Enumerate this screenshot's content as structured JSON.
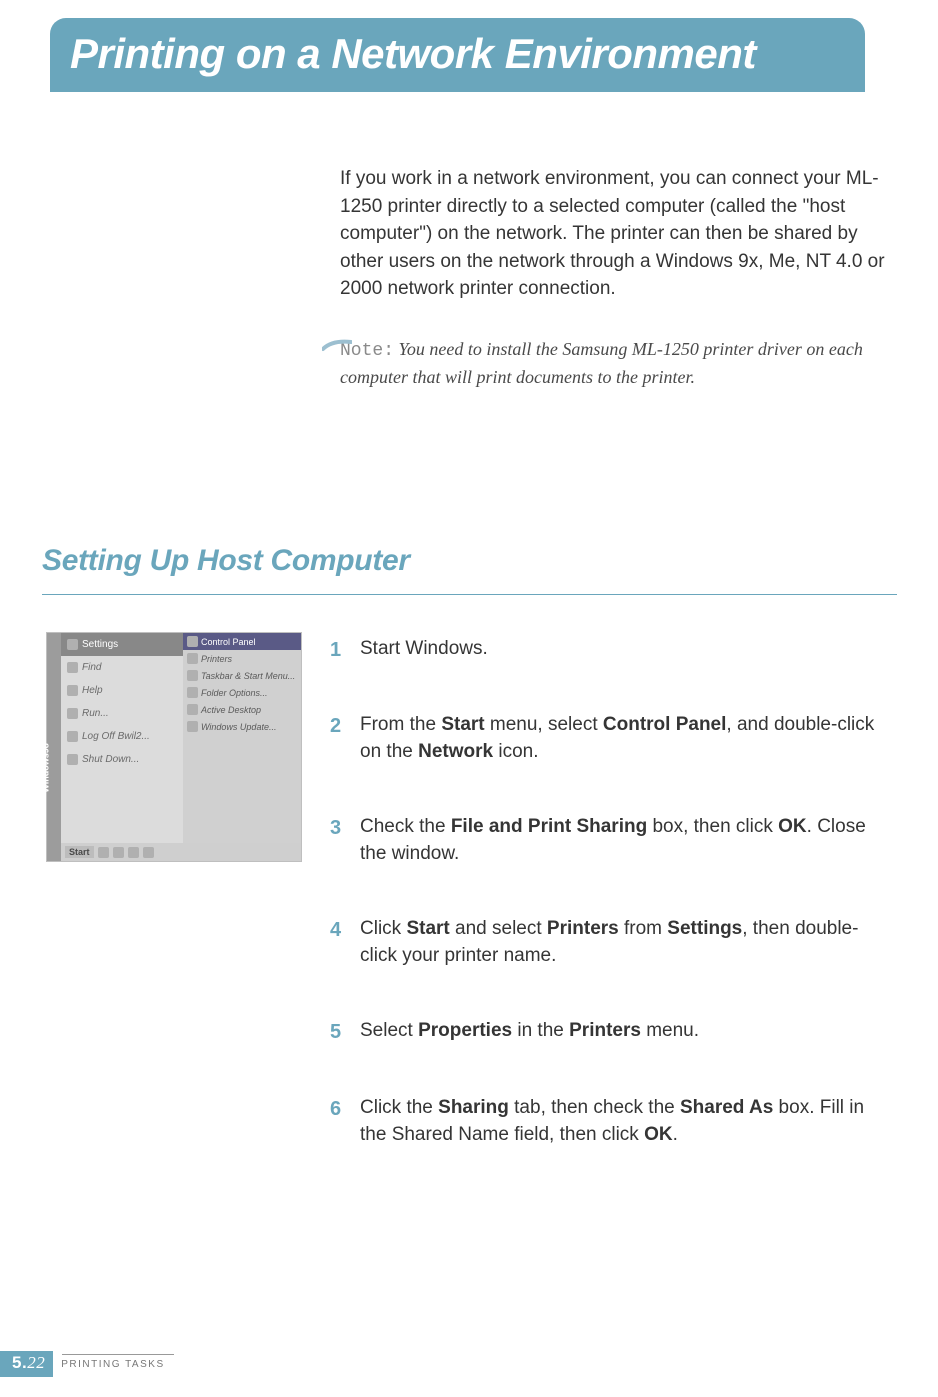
{
  "banner": {
    "title": "Printing on a Network Environment"
  },
  "intro": "If you work in a network environment, you can connect your ML-1250 printer directly to a selected computer (called the \"host computer\") on the network. The printer can then be shared  by other users on the network through a Windows 9x, Me, NT 4.0 or 2000 network printer connection.",
  "note": {
    "label": "Note:",
    "text": " You need to install the Samsung ML-1250 printer driver on each computer that will print documents to the printer."
  },
  "section_title": "Setting Up Host Computer",
  "screenshot": {
    "os_label": "Windows98",
    "left_menu": [
      {
        "label": "Settings",
        "highlight": true
      },
      {
        "label": "Find",
        "highlight": false
      },
      {
        "label": "Help",
        "highlight": false
      },
      {
        "label": "Run...",
        "highlight": false
      },
      {
        "label": "Log Off Bwil2...",
        "highlight": false
      },
      {
        "label": "Shut Down...",
        "highlight": false
      }
    ],
    "right_menu": [
      {
        "label": "Control Panel",
        "highlight": true
      },
      {
        "label": "Printers",
        "highlight": false
      },
      {
        "label": "Taskbar & Start Menu...",
        "highlight": false
      },
      {
        "label": "Folder Options...",
        "highlight": false
      },
      {
        "label": "Active Desktop",
        "highlight": false
      },
      {
        "label": "Windows Update...",
        "highlight": false
      }
    ],
    "taskbar": {
      "start": "Start"
    }
  },
  "steps": [
    {
      "num": "1",
      "html": "Start Windows."
    },
    {
      "num": "2",
      "html": "From the <b>Start</b> menu, select <b>Control Panel</b>, and double-click on the <b>Network</b> icon."
    },
    {
      "num": "3",
      "html": "Check the <b>File and Print Sharing</b> box, then click <b>OK</b>. Close the window."
    },
    {
      "num": "4",
      "html": "Click <b>Start</b> and select <b>Printers</b> from <b>Settings</b>, then double-click your printer name."
    },
    {
      "num": "5",
      "html": "Select <b>Properties</b> in the <b>Printers</b> menu."
    },
    {
      "num": "6",
      "html": "Click the <b>Sharing</b> tab, then check the <b>Shared As</b> box. Fill in the Shared Name field, then click <b>OK</b>."
    }
  ],
  "footer": {
    "chapter": "5.",
    "page": "22",
    "label": "PRINTING TASKS"
  }
}
